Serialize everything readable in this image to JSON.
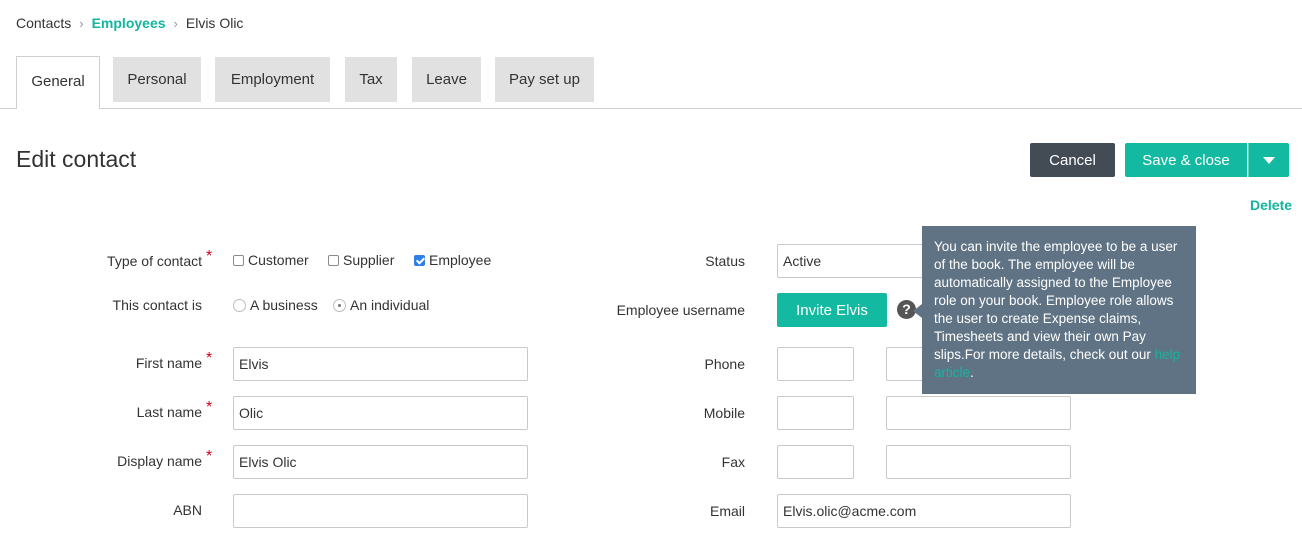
{
  "breadcrumb": {
    "items": [
      "Contacts",
      "Employees",
      "Elvis Olic"
    ]
  },
  "tabs": [
    "General",
    "Personal",
    "Employment",
    "Tax",
    "Leave",
    "Pay set up"
  ],
  "active_tab": "General",
  "page_title": "Edit contact",
  "actions": {
    "cancel_label": "Cancel",
    "save_label": "Save & close",
    "delete_label": "Delete"
  },
  "form_left": {
    "type_of_contact": {
      "label": "Type of contact",
      "options": [
        {
          "label": "Customer",
          "checked": false
        },
        {
          "label": "Supplier",
          "checked": false
        },
        {
          "label": "Employee",
          "checked": true
        }
      ]
    },
    "this_contact_is": {
      "label": "This contact is",
      "options": [
        {
          "label": "A business",
          "selected": false
        },
        {
          "label": "An individual",
          "selected": true
        }
      ]
    },
    "first_name": {
      "label": "First name",
      "value": "Elvis"
    },
    "last_name": {
      "label": "Last name",
      "value": "Olic"
    },
    "display_name": {
      "label": "Display name",
      "value": "Elvis Olic"
    },
    "abn": {
      "label": "ABN",
      "value": ""
    }
  },
  "form_right": {
    "status": {
      "label": "Status",
      "value": "Active"
    },
    "employee_username": {
      "label": "Employee username",
      "invite_label": "Invite Elvis"
    },
    "phone": {
      "label": "Phone",
      "area": "",
      "number": ""
    },
    "mobile": {
      "label": "Mobile",
      "area": "",
      "number": ""
    },
    "fax": {
      "label": "Fax",
      "area": "",
      "number": ""
    },
    "email": {
      "label": "Email",
      "value": "Elvis.olic@acme.com"
    }
  },
  "tooltip": {
    "text": "You can invite the employee to be a user of the book. The employee will be automatically assigned to the Employee role on your book. Employee role allows the user to create Expense claims, Timesheets and view their own Pay slips.For more details, check out our ",
    "link_text": "help article",
    "suffix": "."
  },
  "icons": {
    "help": "question-circle-icon",
    "breadcrumb_separator": "chevron-right-icon",
    "dropdown": "caret-down-icon"
  },
  "colors": {
    "accent": "#14b9a2",
    "dark_button": "#434c55",
    "tooltip_bg": "#5f7384",
    "required": "#d0021b",
    "checkbox_checked": "#2f7fe6"
  }
}
